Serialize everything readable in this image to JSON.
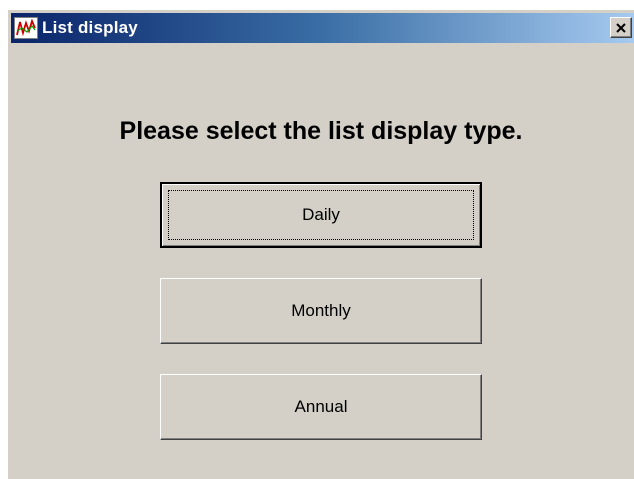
{
  "window": {
    "title": "List display",
    "icon": "graph-chart-icon",
    "close_icon": "close-x-icon"
  },
  "dialog": {
    "prompt": "Please select the list display type.",
    "buttons": [
      {
        "label": "Daily",
        "default": true
      },
      {
        "label": "Monthly",
        "default": false
      },
      {
        "label": "Annual",
        "default": false
      }
    ]
  }
}
